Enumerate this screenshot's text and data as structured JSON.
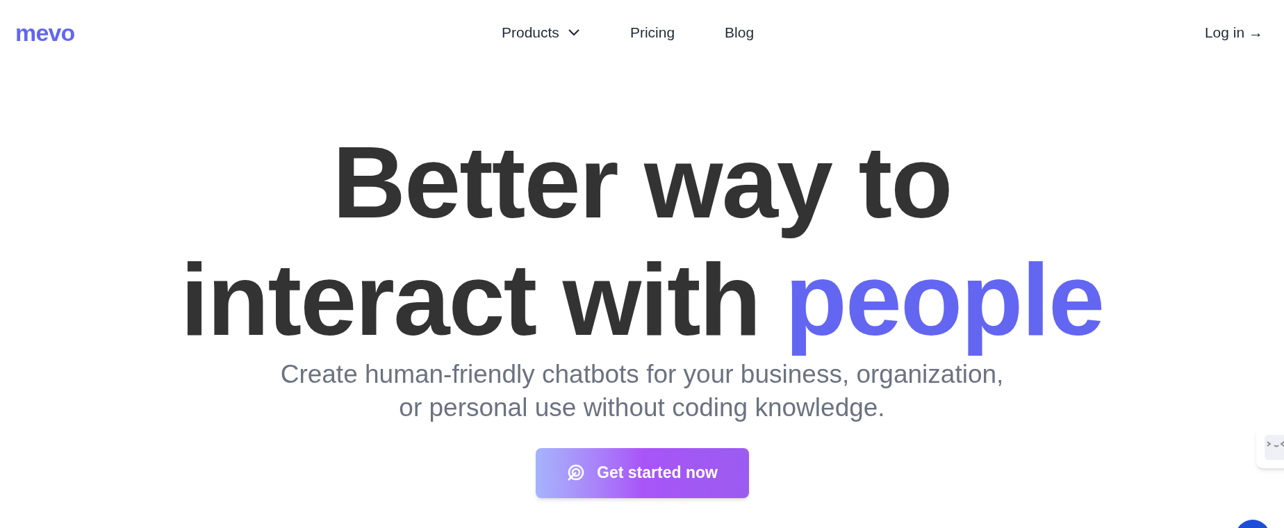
{
  "logo": "mevo",
  "nav": {
    "items": [
      {
        "label": "Products",
        "kind": "dropdown"
      },
      {
        "label": "Pricing",
        "kind": "link"
      },
      {
        "label": "Blog",
        "kind": "link"
      }
    ],
    "login": "Log in →"
  },
  "hero": {
    "line1": "Better way to",
    "line2_start": "interact with",
    "line2_highlight": "people",
    "subtitle_line1": "Create human-friendly chatbots for your business, organization,",
    "subtitle_line2": "or personal use without coding knowledge.",
    "cta": "Get started now"
  }
}
